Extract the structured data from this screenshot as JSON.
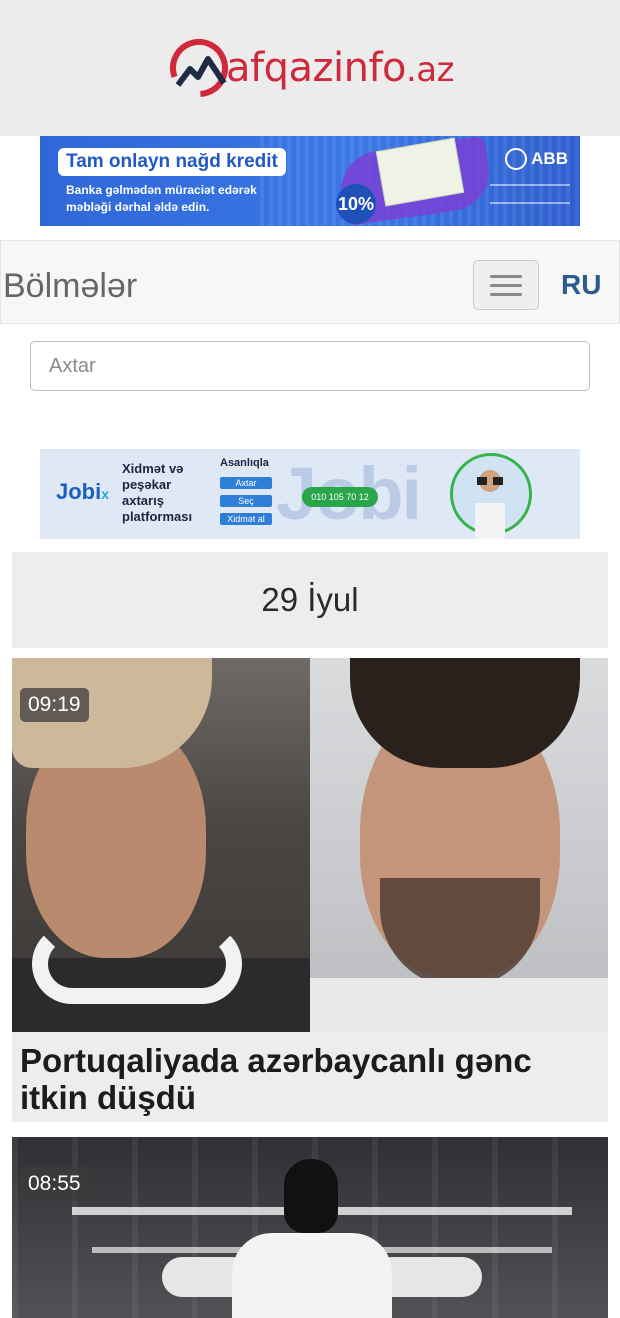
{
  "header": {
    "logo_text": "afqazinfo",
    "logo_tld": ".az"
  },
  "banner_top": {
    "title": "Tam onlayn nağd kredit",
    "subtitle": "Banka gəlmədən müraciət edərək məbləği dərhal əldə edin.",
    "rate": "10%",
    "bank": "ABB"
  },
  "navbar": {
    "sections_label": "Bölmələr",
    "language": "RU"
  },
  "search": {
    "placeholder": "Axtar"
  },
  "banner_jobix": {
    "logo": "Jobi",
    "logo_suffix": "x",
    "description": "Xidmət və peşəkar axtarış platforması",
    "easy": "Asanlıqla",
    "buttons": [
      "Axtar",
      "Seç",
      "Xidmət al"
    ],
    "phone": "010 105 70 12"
  },
  "date_header": "29 İyul",
  "news": [
    {
      "time": "09:19",
      "title": "Portuqaliyada azərbaycanlı gənc itkin düşdü"
    },
    {
      "time": "08:55",
      "title": ""
    }
  ],
  "colors": {
    "brand_red": "#d0283c",
    "header_bg": "#ececec",
    "ru_blue": "#2c5a8c"
  }
}
